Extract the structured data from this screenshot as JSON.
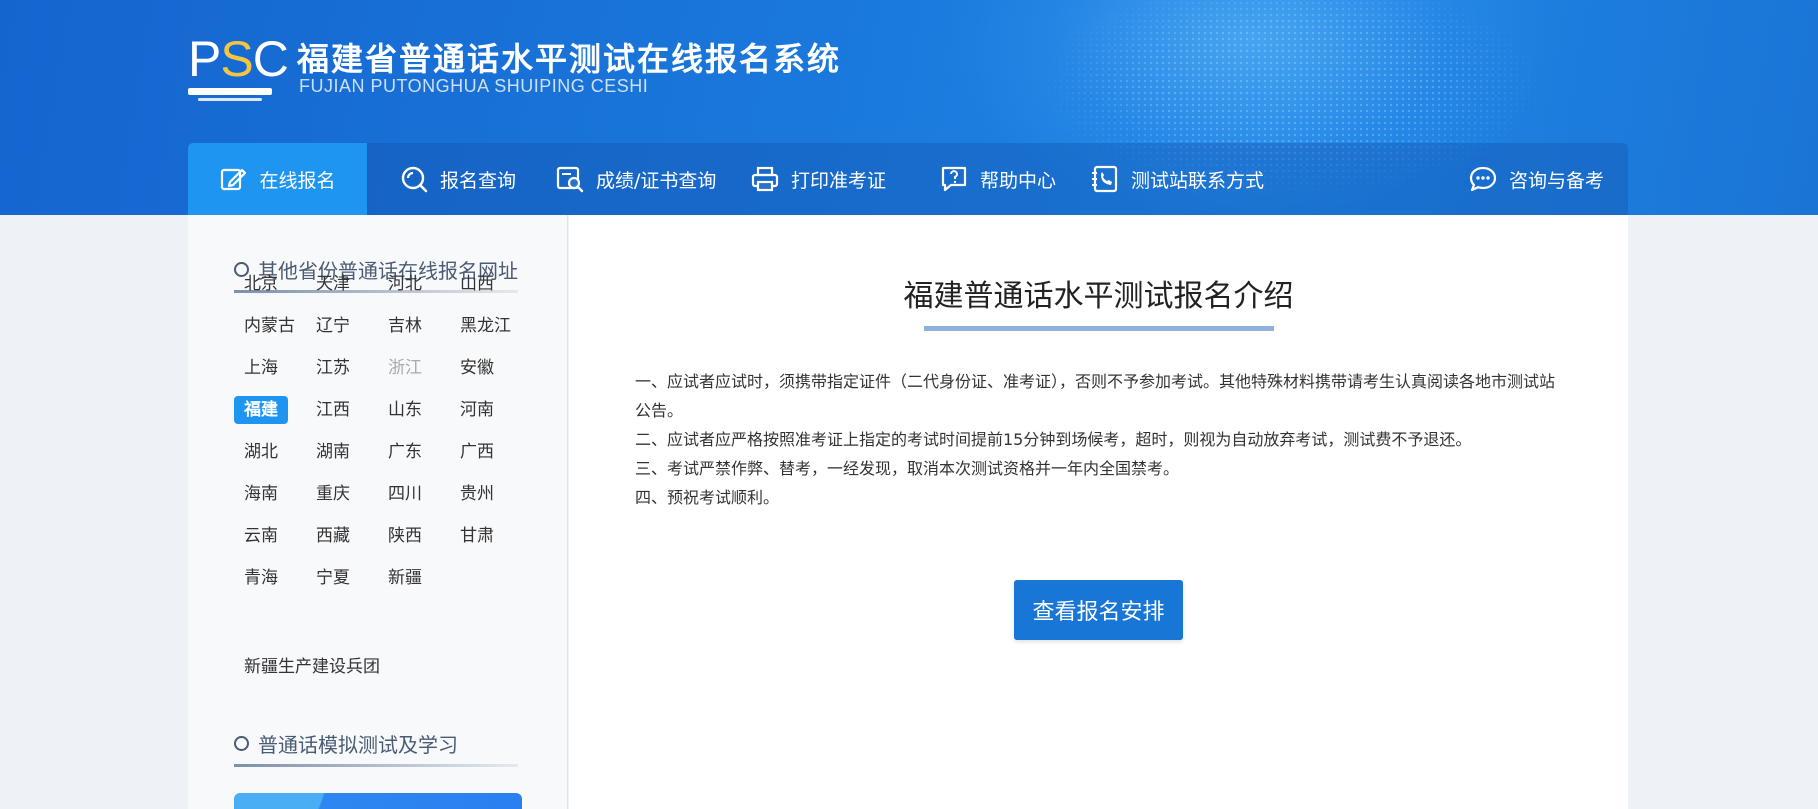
{
  "header": {
    "logo_text": "PSC",
    "title": "福建省普通话水平测试在线报名系统",
    "subtitle": "FUJIAN PUTONGHUA SHUIPING CESHI"
  },
  "nav": {
    "items": [
      {
        "label": "在线报名",
        "icon": "edit-icon",
        "active": true
      },
      {
        "label": "报名查询",
        "icon": "search-icon"
      },
      {
        "label": "成绩/证书查询",
        "icon": "certificate-search-icon"
      },
      {
        "label": "打印准考证",
        "icon": "printer-icon"
      },
      {
        "label": "帮助中心",
        "icon": "help-icon"
      },
      {
        "label": "测试站联系方式",
        "icon": "phone-book-icon"
      },
      {
        "label": "咨询与备考",
        "icon": "chat-icon"
      }
    ]
  },
  "sidebar": {
    "section1_title": "其他省份普通话在线报名网址",
    "provinces": [
      "北京",
      "天津",
      "河北",
      "山西",
      "内蒙古",
      "辽宁",
      "吉林",
      "黑龙江",
      "上海",
      "江苏",
      "浙江",
      "安徽",
      "福建",
      "江西",
      "山东",
      "河南",
      "湖北",
      "湖南",
      "广东",
      "广西",
      "海南",
      "重庆",
      "四川",
      "贵州",
      "云南",
      "西藏",
      "陕西",
      "甘肃",
      "青海",
      "宁夏",
      "新疆"
    ],
    "active_province": "福建",
    "disabled_province": "浙江",
    "extra_link": "新疆生产建设兵团",
    "section2_title": "普通话模拟测试及学习"
  },
  "main": {
    "title": "福建普通话水平测试报名介绍",
    "notices": [
      "一、应试者应试时，须携带指定证件（二代身份证、准考证），否则不予参加考试。其他特殊材料携带请考生认真阅读各地市测试站公告。",
      "二、应试者应严格按照准考证上指定的考试时间提前15分钟到场候考，超时，则视为自动放弃考试，测试费不予退还。",
      "三、考试严禁作弊、替考，一经发现，取消本次测试资格并一年内全国禁考。",
      "四、预祝考试顺利。"
    ],
    "cta_label": "查看报名安排"
  },
  "colors": {
    "header_blue": "#1a78dc",
    "nav_active": "#1f95f2",
    "button_blue": "#1776d6",
    "logo_accent": "#f4c542"
  }
}
